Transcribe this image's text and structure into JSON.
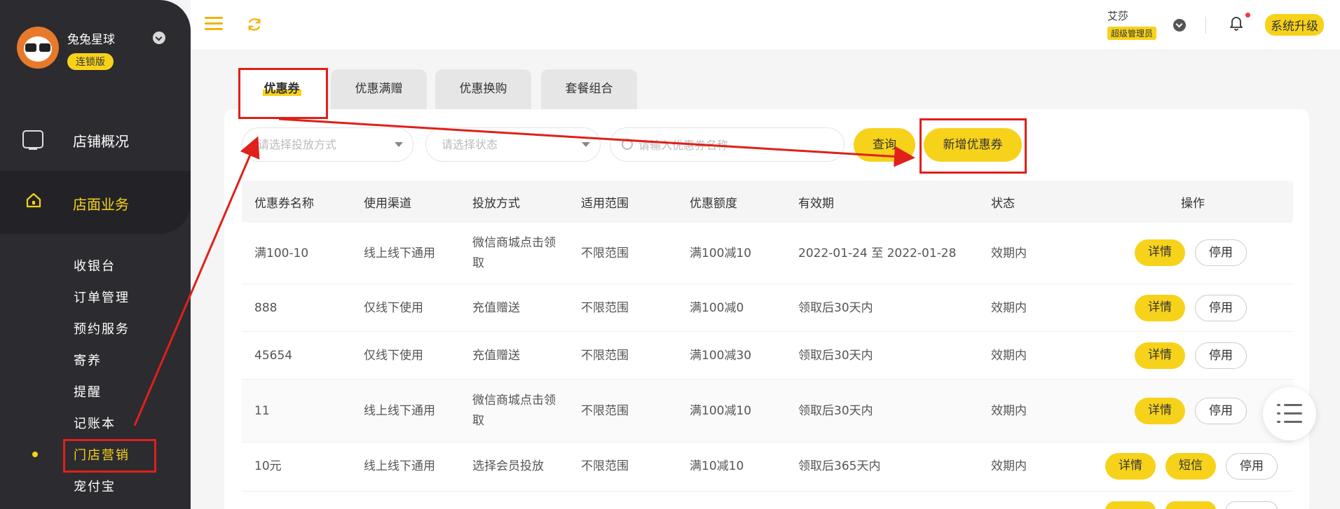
{
  "sidebar": {
    "store_name": "兔兔星球",
    "store_badge": "连锁版",
    "top_item": {
      "label": "店铺概况",
      "icon": "monitor-icon"
    },
    "active_item": {
      "label": "店面业务",
      "icon": "home-icon"
    },
    "sub_items": [
      "收银台",
      "订单管理",
      "预约服务",
      "寄养",
      "提醒",
      "记账本",
      "门店营销",
      "宠付宝"
    ],
    "selected_sub": "门店营销"
  },
  "header": {
    "user_name": "艾莎",
    "user_role": "超级管理员",
    "upgrade_label": "系统升级"
  },
  "tabs": [
    "优惠券",
    "优惠满赠",
    "优惠换购",
    "套餐组合"
  ],
  "filters": {
    "method_placeholder": "请选择投放方式",
    "status_placeholder": "请选择状态",
    "search_placeholder": "请输入优惠券名称",
    "query_label": "查询",
    "add_label": "新增优惠券"
  },
  "table": {
    "columns": [
      "优惠券名称",
      "使用渠道",
      "投放方式",
      "适用范围",
      "优惠额度",
      "有效期",
      "状态",
      "操作"
    ],
    "rows": [
      {
        "name": "满100-10",
        "channel": "线上线下通用",
        "method": "微信商城点击领取",
        "scope": "不限范围",
        "amount": "满100减10",
        "validity": "2022-01-24 至 2022-01-28",
        "status": "效期内",
        "actions": [
          "详情",
          "停用"
        ]
      },
      {
        "name": "888",
        "channel": "仅线下使用",
        "method": "充值赠送",
        "scope": "不限范围",
        "amount": "满100减0",
        "validity": "领取后30天内",
        "status": "效期内",
        "actions": [
          "详情",
          "停用"
        ]
      },
      {
        "name": "45654",
        "channel": "仅线下使用",
        "method": "充值赠送",
        "scope": "不限范围",
        "amount": "满100减30",
        "validity": "领取后30天内",
        "status": "效期内",
        "actions": [
          "详情",
          "停用"
        ]
      },
      {
        "name": "11",
        "channel": "线上线下通用",
        "method": "微信商城点击领取",
        "scope": "不限范围",
        "amount": "满100减10",
        "validity": "领取后30天内",
        "status": "效期内",
        "actions": [
          "详情",
          "停用"
        ]
      },
      {
        "name": "10元",
        "channel": "线上线下通用",
        "method": "选择会员投放",
        "scope": "不限范围",
        "amount": "满10减10",
        "validity": "领取后365天内",
        "status": "效期内",
        "actions": [
          "详情",
          "短信",
          "停用"
        ]
      }
    ]
  },
  "colors": {
    "accent": "#f7d21b",
    "sidebar": "#2b2b30",
    "annotation": "#e0201a"
  }
}
